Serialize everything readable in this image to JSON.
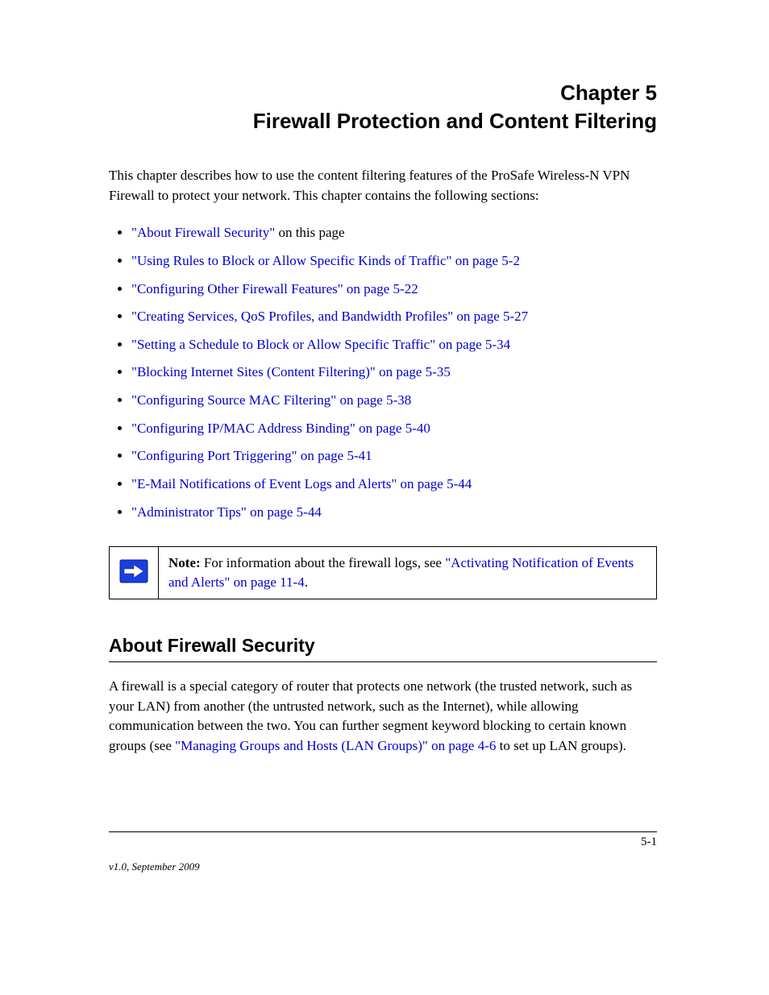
{
  "chapter": {
    "label": "Chapter 5",
    "title": "Firewall Protection and Content Filtering"
  },
  "intro": "This chapter describes how to use the content filtering features of the ProSafe Wireless-N VPN Firewall to protect your network. This chapter contains the following sections:",
  "bullets": [
    {
      "text": "\"About Firewall Security\"",
      "suffix": " on this page"
    },
    {
      "text": "\"Using Rules to Block or Allow Specific Kinds of Traffic\" on page 5-2"
    },
    {
      "text": "\"Configuring Other Firewall Features\" on page 5-22"
    },
    {
      "text": "\"Creating Services, QoS Profiles, and Bandwidth Profiles\" on page 5-27"
    },
    {
      "text": "\"Setting a Schedule to Block or Allow Specific Traffic\" on page 5-34"
    },
    {
      "text": "\"Blocking Internet Sites (Content Filtering)\" on page 5-35"
    },
    {
      "text": "\"Configuring Source MAC Filtering\" on page 5-38"
    },
    {
      "text": "\"Configuring IP/MAC Address Binding\" on page 5-40"
    },
    {
      "text": "\"Configuring Port Triggering\" on page 5-41"
    },
    {
      "text": "\"E-Mail Notifications of Event Logs and Alerts\" on page 5-44"
    },
    {
      "text": "\"Administrator Tips\" on page 5-44"
    }
  ],
  "note": {
    "label": "Note:",
    "text": " For information about the firewall logs, see ",
    "xref": "\"Activating Notification of Events and Alerts\" on page 11-4",
    "trail": "."
  },
  "section_heading": "About Firewall Security",
  "section_body": "A firewall is a special category of router that protects one network (the trusted network, such as your LAN) from another (the untrusted network, such as the Internet), while allowing communication between the two. You can further segment keyword blocking to certain known groups (see ",
  "section_xref": "\"Managing Groups and Hosts (LAN Groups)\" on page 4-6",
  "section_body_tail": " to set up LAN groups).",
  "footer": {
    "page": "5-1",
    "version": "v1.0, September 2009"
  }
}
